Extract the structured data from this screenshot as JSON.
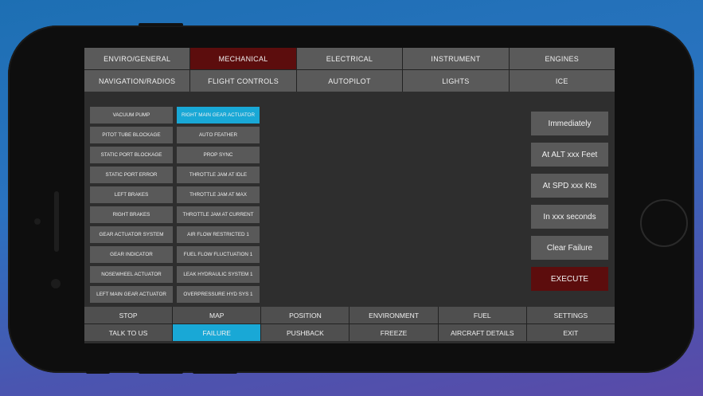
{
  "top_tabs": [
    {
      "label": "ENVIRO/GENERAL",
      "active": false
    },
    {
      "label": "MECHANICAL",
      "active": true
    },
    {
      "label": "ELECTRICAL",
      "active": false
    },
    {
      "label": "INSTRUMENT",
      "active": false
    },
    {
      "label": "ENGINES",
      "active": false
    },
    {
      "label": "NAVIGATION/RADIOS",
      "active": false
    },
    {
      "label": "FLIGHT CONTROLS",
      "active": false
    },
    {
      "label": "AUTOPILOT",
      "active": false
    },
    {
      "label": "LIGHTS",
      "active": false
    },
    {
      "label": "ICE",
      "active": false
    }
  ],
  "failures": [
    {
      "label": "VACUUM PUMP",
      "selected": false
    },
    {
      "label": "RIGHT MAIN GEAR ACTUATOR",
      "selected": true
    },
    {
      "label": "PITOT TUBE BLOCKAGE",
      "selected": false
    },
    {
      "label": "AUTO FEATHER",
      "selected": false
    },
    {
      "label": "STATIC PORT BLOCKAGE",
      "selected": false
    },
    {
      "label": "PROP SYNC",
      "selected": false
    },
    {
      "label": "STATIC PORT ERROR",
      "selected": false
    },
    {
      "label": "THROTTLE JAM AT IDLE",
      "selected": false
    },
    {
      "label": "LEFT BRAKES",
      "selected": false
    },
    {
      "label": "THROTTLE JAM AT MAX",
      "selected": false
    },
    {
      "label": "RIGHT BRAKES",
      "selected": false
    },
    {
      "label": "THROTTLE JAM AT CURRENT",
      "selected": false
    },
    {
      "label": "GEAR ACTUATOR SYSTEM",
      "selected": false
    },
    {
      "label": "AIR FLOW RESTRICTED 1",
      "selected": false
    },
    {
      "label": "GEAR INDICATOR",
      "selected": false
    },
    {
      "label": "FUEL FLOW FLUCTUATION 1",
      "selected": false
    },
    {
      "label": "NOSEWHEEL ACTUATOR",
      "selected": false
    },
    {
      "label": "LEAK HYDRAULIC SYSTEM 1",
      "selected": false
    },
    {
      "label": "LEFT MAIN GEAR ACTUATOR",
      "selected": false
    },
    {
      "label": "OVERPRESSURE HYD SYS 1",
      "selected": false
    }
  ],
  "timing": {
    "immediately": "Immediately",
    "at_alt": "At ALT xxx Feet",
    "at_spd": "At SPD xxx Kts",
    "in_seconds": "In xxx seconds",
    "clear": "Clear Failure",
    "execute": "EXECUTE"
  },
  "bottom_nav": [
    {
      "label": "STOP",
      "active": false
    },
    {
      "label": "MAP",
      "active": false
    },
    {
      "label": "POSITION",
      "active": false
    },
    {
      "label": "ENVIRONMENT",
      "active": false
    },
    {
      "label": "FUEL",
      "active": false
    },
    {
      "label": "SETTINGS",
      "active": false
    },
    {
      "label": "TALK TO US",
      "active": false
    },
    {
      "label": "FAILURE",
      "active": true
    },
    {
      "label": "PUSHBACK",
      "active": false
    },
    {
      "label": "FREEZE",
      "active": false
    },
    {
      "label": "AIRCRAFT DETAILS",
      "active": false
    },
    {
      "label": "EXIT",
      "active": false
    }
  ],
  "colors": {
    "active_tab": "#5c0d0d",
    "selected_accent": "#19a8d6",
    "button_gray": "#5a5a5a"
  }
}
